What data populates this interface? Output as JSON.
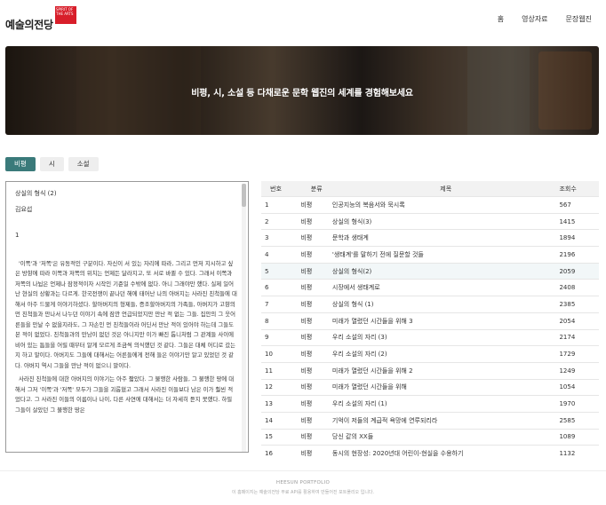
{
  "header": {
    "logo_badge": "SPIRIT OF THE ARTS",
    "logo_text": "예술의전당",
    "nav": [
      "홈",
      "영상자료",
      "문장웹진"
    ]
  },
  "hero": {
    "text": "비평, 시, 소설 등 다채로운 문학 웹진의 세계를 경험해보세요"
  },
  "tabs": [
    "비평",
    "시",
    "소설"
  ],
  "reader": {
    "title": "상실의 형식 (2)",
    "author": "김요섭",
    "section": "1",
    "paragraphs": [
      "'이쪽'과 '저쪽'은 유동적인 구분이다. 자신이 서 있는 자리에 따라, 그리고 먼저 지시하고 싶은 방향에 따라 이쪽과 저쪽의 위치는 언제든 달라지고, 또 서로 바뀔 수 있다. 그래서 이쪽과 저쪽의 나뉨은 언제나 잠정적이자 시작인 기준일 수밖에 없다. 아니 그래야만 했다. 실제 일어난 현실의 상황과는 다르게. 한국전쟁이 끝나던 해에 태어난 나의 아버지는 사라진 친척들에 대해서 아주 드물게 이야기하셨다. 할아버지의 형제들, 증조할아버지의 가족들, 아버지가 고향의 먼 친척들과 만나서 나누던 이야기 속에 잠깐 언급되었지만 만난 적 없는 그들. 집안의 그 웃어른들을 만날 수 없을지라도, 그 자손인 먼 친척들이라 어딘서 만난 적이 있어야 하는데 그들도 본 적이 없었다. 친척들과의 만남이 없던 것은 아니지만 이가 빠진 톱니처럼 그 관계들 사이에 비어 있는 틈들을 어릴 때부터 알게 모르게 조금씩 의식했던 것 같다. 그들은 대체 어디로 갔는지 하고 말이다. 아버지도 그들에 대해서는 어른들에게 전해 들은 이야기만 알고 있었던 것 같다. 아버지 역시 그들을 만난 적이 없으니 말이다.",
      "사라진 친척들에 대한 아버지의 이야기는 아주 짧았다. 그 불행한 사람들, 그 불행한 땅에 대해서 그저 '이쪽'과 '저쪽' 모두가 그들을 괴롭혔고 그래서 사라진 이들보다 남은 이가 훨씬 적었다고. 그 사라진 이들의 이름이나 나이, 다른 사연에 대해서는 더 자세히 듣지 못했다. 하필 그들이 살았던 그 불행한 땅은"
    ]
  },
  "table": {
    "headers": [
      "번호",
      "분류",
      "제목",
      "조회수"
    ],
    "rows": [
      {
        "no": "1",
        "cat": "비평",
        "title": "인공지능의 복음서와 묵시록",
        "views": "567"
      },
      {
        "no": "2",
        "cat": "비평",
        "title": "상실의 형식(3)",
        "views": "1415"
      },
      {
        "no": "3",
        "cat": "비평",
        "title": "문학과 생태계",
        "views": "1894"
      },
      {
        "no": "4",
        "cat": "비평",
        "title": "'생태계'를 말하기 전에 질문할 것들",
        "views": "2196"
      },
      {
        "no": "5",
        "cat": "비평",
        "title": "상실의 형식(2)",
        "views": "2059"
      },
      {
        "no": "6",
        "cat": "비평",
        "title": "시장에서 생태계로",
        "views": "2408"
      },
      {
        "no": "7",
        "cat": "비평",
        "title": "상실의 형식 (1)",
        "views": "2385"
      },
      {
        "no": "8",
        "cat": "비평",
        "title": "미래가 열렸던 시간들을 위해 3",
        "views": "2054"
      },
      {
        "no": "9",
        "cat": "비평",
        "title": "우리 소설의 자리 (3)",
        "views": "2174"
      },
      {
        "no": "10",
        "cat": "비평",
        "title": "우리 소설의 자리 (2)",
        "views": "1729"
      },
      {
        "no": "11",
        "cat": "비평",
        "title": "미래가 열렸던 시간들을 위해 2",
        "views": "1249"
      },
      {
        "no": "12",
        "cat": "비평",
        "title": "미래가 열렸던 시간들을 위해",
        "views": "1054"
      },
      {
        "no": "13",
        "cat": "비평",
        "title": "우리 소설의 자리 (1)",
        "views": "1970"
      },
      {
        "no": "14",
        "cat": "비평",
        "title": "기억이 저들의 계급적 욕망에 연루되리라",
        "views": "2585"
      },
      {
        "no": "15",
        "cat": "비평",
        "title": "당신 같의 XX들",
        "views": "1089"
      },
      {
        "no": "16",
        "cat": "비평",
        "title": "동시의 현장성: 2020년대 어린이-현실을 수용하기",
        "views": "1132"
      }
    ]
  },
  "footer": {
    "line1": "HEESUN PORTFOLIO",
    "line2": "이 홈페이지는 예술의전당 무료 API를 활용하여 만들어진 포트폴리오 입니다."
  },
  "colors": {
    "tab_active": "#3a7a7a",
    "logo_badge": "#d81e2a",
    "row_highlight": "#f2f7f8"
  }
}
